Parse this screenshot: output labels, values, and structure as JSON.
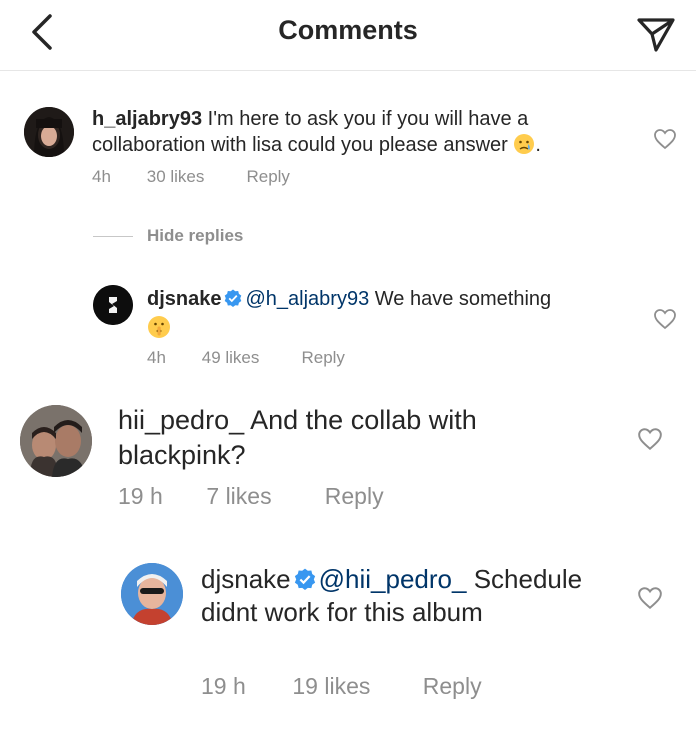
{
  "header": {
    "title": "Comments"
  },
  "comments": [
    {
      "username": "h_aljabry93",
      "text": "I'm here to ask you if you will have a collaboration with lisa could you please answer",
      "text_tail": ".",
      "time": "4h",
      "likes": "30 likes",
      "reply": "Reply"
    },
    {
      "username": "djsnake",
      "mention": "@h_aljabry93",
      "text": "We have something",
      "time": "4h",
      "likes": "49 likes",
      "reply": "Reply"
    },
    {
      "username": "hii_pedro_",
      "text": "And the collab with blackpink?",
      "time": "19 h",
      "likes": "7 likes",
      "reply": "Reply"
    },
    {
      "username": "djsnake",
      "mention": "@hii_pedro_",
      "text": "Schedule didnt work for this album",
      "time": "19 h",
      "likes": "19 likes",
      "reply": "Reply"
    }
  ],
  "thread": {
    "hide_replies": "Hide replies"
  },
  "icons": {
    "back": "chevron-left-icon",
    "send": "paper-plane-icon",
    "heart": "heart-outline-icon",
    "verified": "verified-badge-icon",
    "crying": "crying-face-emoji",
    "shushing": "shushing-face-emoji"
  },
  "colors": {
    "text": "#262626",
    "meta": "#8e8e8e",
    "mention": "#003569",
    "verified": "#3897f0"
  }
}
